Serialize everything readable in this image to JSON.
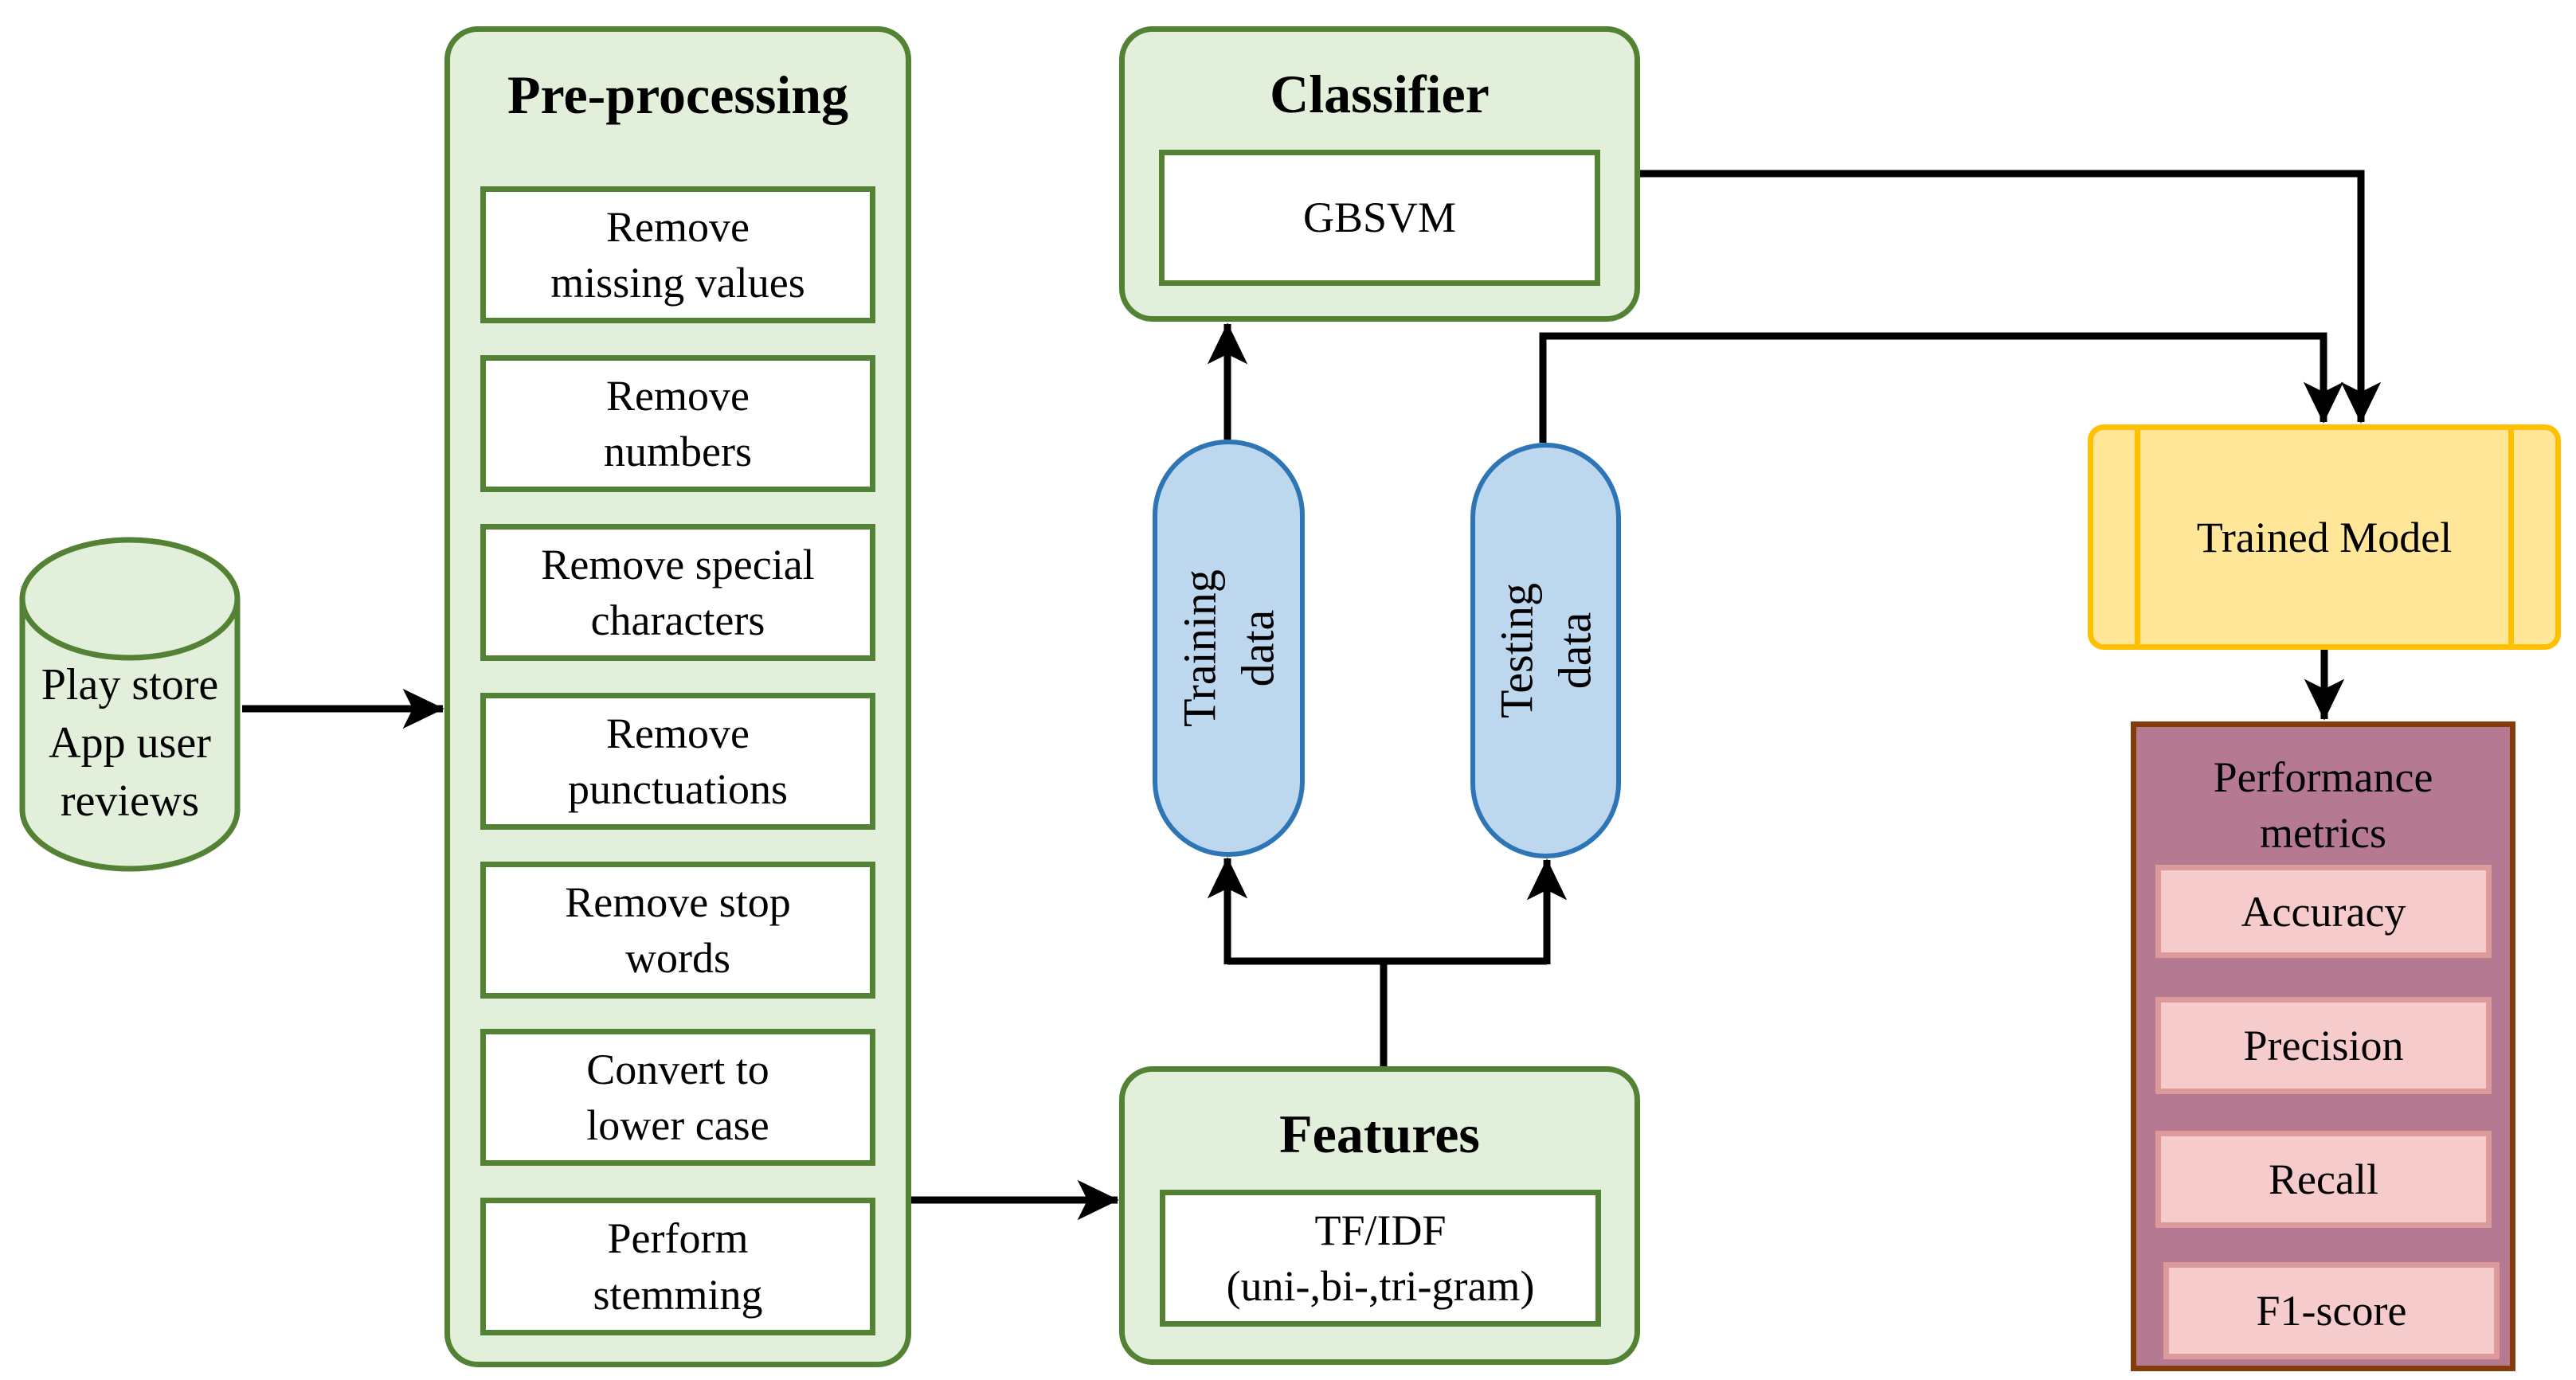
{
  "source": {
    "label": "Play store\nApp user\nreviews"
  },
  "preprocessing": {
    "title": "Pre-processing",
    "steps": [
      "Remove\nmissing values",
      "Remove\nnumbers",
      "Remove special\ncharacters",
      "Remove\npunctuations",
      "Remove stop\nwords",
      "Convert to\nlower case",
      "Perform\nstemming"
    ]
  },
  "classifier": {
    "title": "Classifier",
    "model": "GBSVM"
  },
  "features": {
    "title": "Features",
    "method": "TF/IDF\n(uni-,bi-,tri-gram)"
  },
  "splits": {
    "training": "Training\ndata",
    "testing": "Testing\ndata"
  },
  "trained_model": {
    "label": "Trained Model"
  },
  "performance": {
    "title": "Performance\nmetrics",
    "metrics": [
      "Accuracy",
      "Precision",
      "Recall",
      "F1-score"
    ]
  },
  "colors": {
    "group_fill": "#e2efda",
    "group_border": "#548235",
    "pill_fill": "#bdd7ee",
    "pill_border": "#2e75b6",
    "trained_fill": "#ffe699",
    "trained_border": "#ffc000",
    "perf_fill": "#b57a92",
    "perf_border": "#843c0c",
    "metric_fill": "#f6cbcb",
    "metric_border": "#dc9a9a"
  }
}
